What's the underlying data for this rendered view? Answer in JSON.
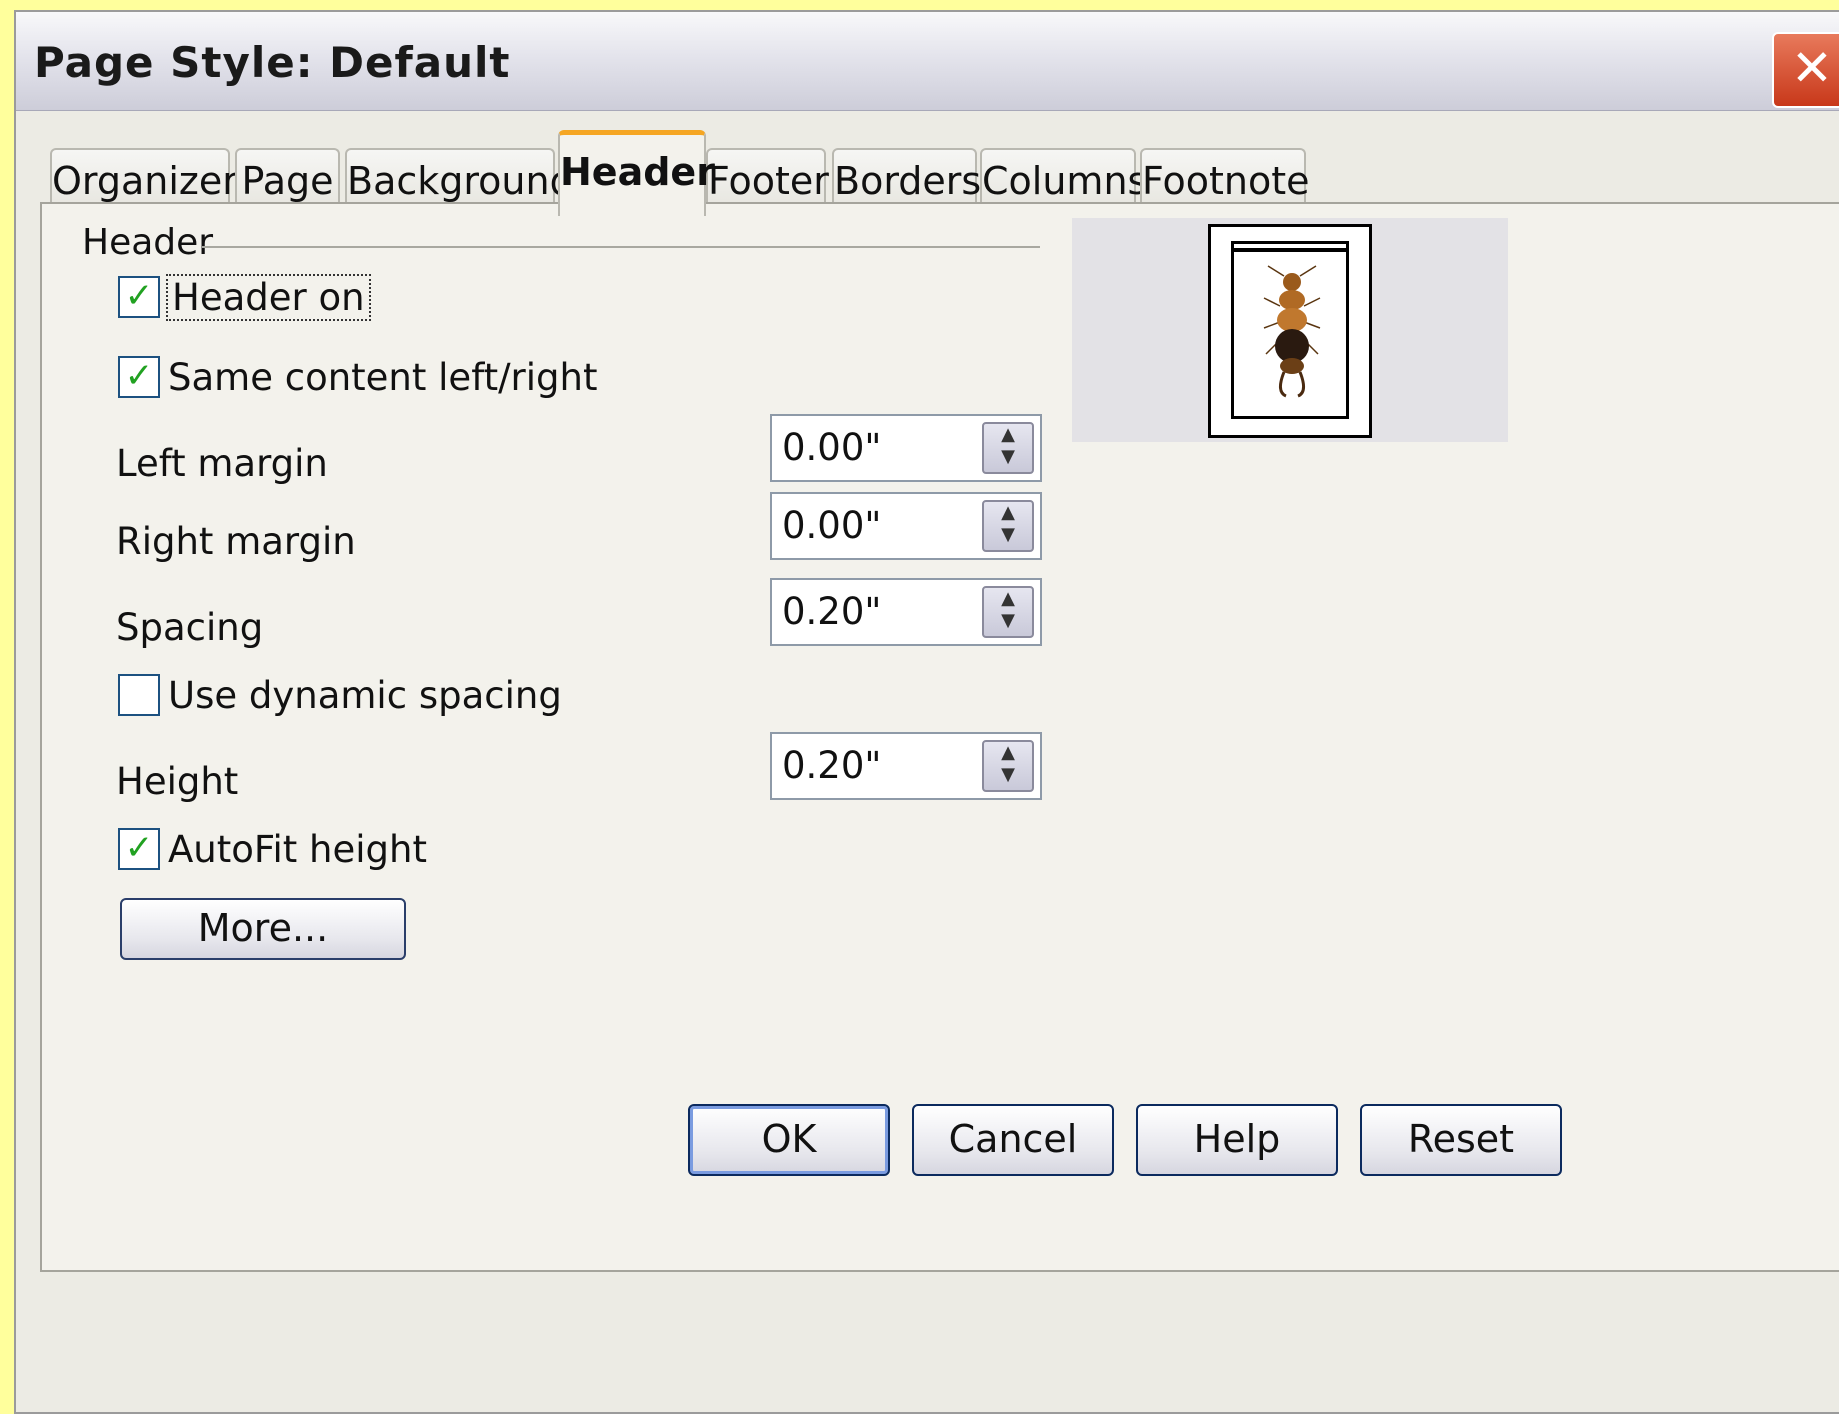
{
  "dialog": {
    "title": "Page Style: Default",
    "close_symbol": "✕"
  },
  "tabs": [
    {
      "label": "Organizer",
      "active": false
    },
    {
      "label": "Page",
      "active": false
    },
    {
      "label": "Background",
      "active": false
    },
    {
      "label": "Header",
      "active": true
    },
    {
      "label": "Footer",
      "active": false
    },
    {
      "label": "Borders",
      "active": false
    },
    {
      "label": "Columns",
      "active": false
    },
    {
      "label": "Footnote",
      "active": false
    }
  ],
  "header_section": {
    "group_label": "Header",
    "header_on": {
      "label": "Header on",
      "checked": true
    },
    "same_content": {
      "label": "Same content left/right",
      "checked": true
    },
    "left_margin": {
      "label": "Left margin",
      "value": "0.00\""
    },
    "right_margin": {
      "label": "Right margin",
      "value": "0.00\""
    },
    "spacing": {
      "label": "Spacing",
      "value": "0.20\""
    },
    "dynamic_spacing": {
      "label": "Use dynamic spacing",
      "checked": false
    },
    "height": {
      "label": "Height",
      "value": "0.20\""
    },
    "autofit": {
      "label": "AutoFit height",
      "checked": true
    },
    "more_button": "More..."
  },
  "checkmark": "✓",
  "buttons": {
    "ok": "OK",
    "cancel": "Cancel",
    "help": "Help",
    "reset": "Reset"
  },
  "icons": {
    "spin": "updown-spin-icon",
    "close": "close-icon",
    "preview_image": "insect-image"
  }
}
